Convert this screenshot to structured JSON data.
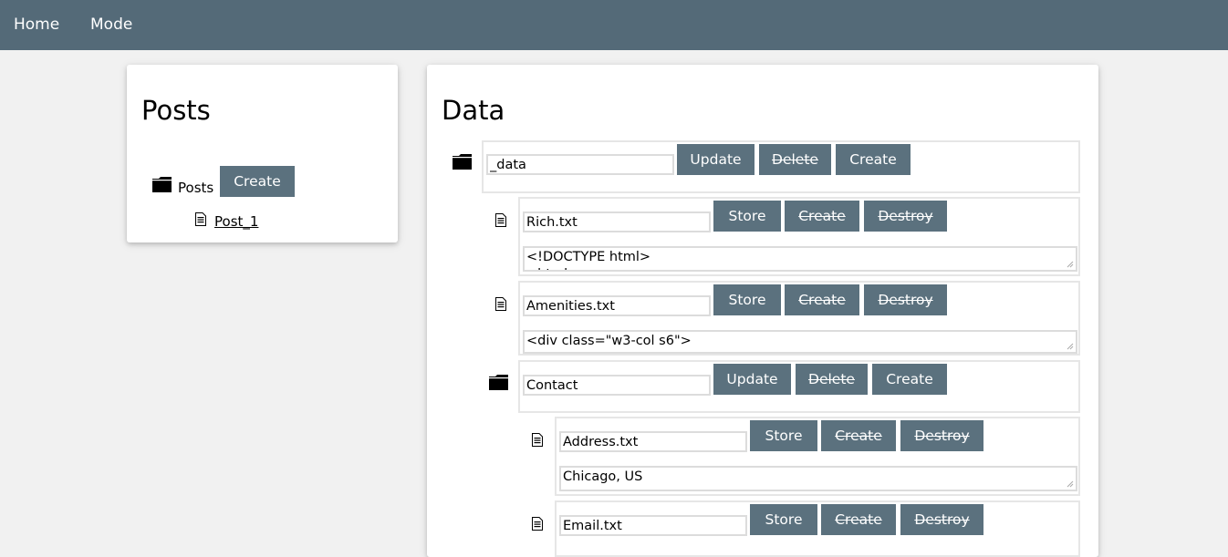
{
  "nav": {
    "home": "Home",
    "mode": "Mode"
  },
  "posts": {
    "title": "Posts",
    "folder_label": "Posts",
    "create_label": "Create",
    "items": [
      {
        "label": "Post_1"
      }
    ]
  },
  "data_panel": {
    "title": "Data",
    "root_folder": {
      "name": "_data",
      "update": "Update",
      "delete": "Delete",
      "create": "Create"
    },
    "files": [
      {
        "name": "Rich.txt",
        "store": "Store",
        "create": "Create",
        "destroy": "Destroy",
        "content": "<!DOCTYPE html>\n<html>"
      },
      {
        "name": "Amenities.txt",
        "store": "Store",
        "create": "Create",
        "destroy": "Destroy",
        "content": "<div class=\"w3-col s6\">"
      }
    ],
    "sub_folder": {
      "name": "Contact",
      "update": "Update",
      "delete": "Delete",
      "create": "Create"
    },
    "sub_files": [
      {
        "name": "Address.txt",
        "store": "Store",
        "create": "Create",
        "destroy": "Destroy",
        "content": "Chicago, US"
      },
      {
        "name": "Email.txt",
        "store": "Store",
        "create": "Create",
        "destroy": "Destroy"
      }
    ]
  },
  "colors": {
    "topbar": "#546a78",
    "button": "#5b717e",
    "background": "#f1f1f1"
  }
}
